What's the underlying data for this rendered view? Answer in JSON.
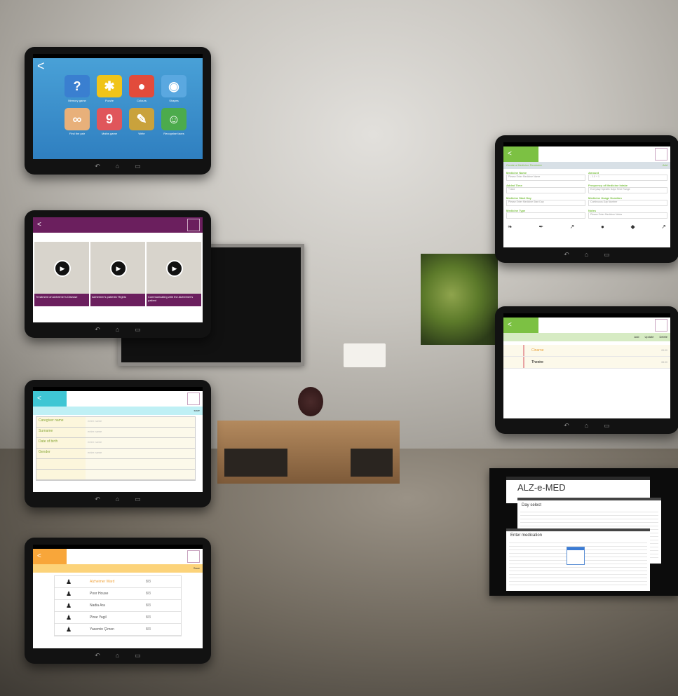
{
  "scene": {
    "description_hidden": ""
  },
  "tablet1": {
    "back_glyph": "<",
    "apps": [
      {
        "glyph": "?",
        "color": "#3a7fd0",
        "label": "Memory game"
      },
      {
        "glyph": "✱",
        "color": "#f0c419",
        "label": "Puzzle"
      },
      {
        "glyph": "●",
        "color": "#e24b3b",
        "label": "Colours"
      },
      {
        "glyph": "◉",
        "color": "#5aa8e0",
        "label": "Shapes"
      },
      {
        "glyph": "∞",
        "color": "#e8b07a",
        "label": "Find the pair"
      },
      {
        "glyph": "9",
        "color": "#e0565b",
        "label": "Maths game"
      },
      {
        "glyph": "✎",
        "color": "#c9a23c",
        "label": "Write"
      },
      {
        "glyph": "☺",
        "color": "#4cab4c",
        "label": "Recognise faces"
      }
    ]
  },
  "tablet2": {
    "back_glyph": "<",
    "play_glyph": "▶",
    "videos": [
      {
        "caption": "Treatment of Alzheimer's Disease"
      },
      {
        "caption": "Alzheimer's patients' Rights"
      },
      {
        "caption": "Communicating with the Alzheimer's patient"
      }
    ]
  },
  "tablet3": {
    "back_glyph": "<",
    "action": "save",
    "rows": [
      {
        "label": "Caregiver name",
        "value": "enter name"
      },
      {
        "label": "Surname",
        "value": "enter name"
      },
      {
        "label": "Date of birth",
        "value": "enter name"
      },
      {
        "label": "Gender",
        "value": "enter name"
      },
      {
        "label": "",
        "value": ""
      },
      {
        "label": "",
        "value": ""
      }
    ]
  },
  "tablet4": {
    "back_glyph": "<",
    "action": "Save",
    "rows": [
      {
        "name": "Alzheimer Ward",
        "detail": "8/3"
      },
      {
        "name": "Poor House",
        "detail": "8/3"
      },
      {
        "name": "Nadia Ara",
        "detail": "8/3"
      },
      {
        "name": "Pinar Yagil",
        "detail": "8/3"
      },
      {
        "name": "Yasemin Çimen",
        "detail": "8/3"
      }
    ]
  },
  "tablet5": {
    "back_glyph": "<",
    "subtitle": "Create a Medicine Reminder",
    "subaction": "Add",
    "left_fields": [
      {
        "label": "Medicine Name",
        "value": "Please Enter Medicine Name"
      },
      {
        "label": "Added Time",
        "value": "+ Add"
      },
      {
        "label": "Medicine Start Day",
        "value": "Please Enter Medicine Start Day"
      },
      {
        "label": "Medicine Type",
        "value": ""
      }
    ],
    "right_fields": [
      {
        "label": "Amount",
        "value": "- 1.0 +  1"
      },
      {
        "label": "Frequency of Medicine Intake",
        "value": "Everyday   Specific Days   Time Range"
      },
      {
        "label": "Medicine Usage Duration",
        "value": "Continuous   Day Number"
      },
      {
        "label": "Notes",
        "value": "Please Enter Medicine Notes"
      }
    ],
    "types": [
      "❧",
      "✒",
      "↗",
      "●",
      "◆",
      "↗"
    ]
  },
  "tablet6": {
    "back_glyph": "<",
    "actions": [
      "Add",
      "Update",
      "Delete"
    ],
    "meds": [
      {
        "name": "Cinarne",
        "time": "09:00"
      },
      {
        "name": "Theoire",
        "time": "08:00"
      }
    ]
  },
  "desktop": {
    "brand": "ALZ-e-MED",
    "panel2_title": "Day select",
    "panel3_title": "Enter medication"
  }
}
